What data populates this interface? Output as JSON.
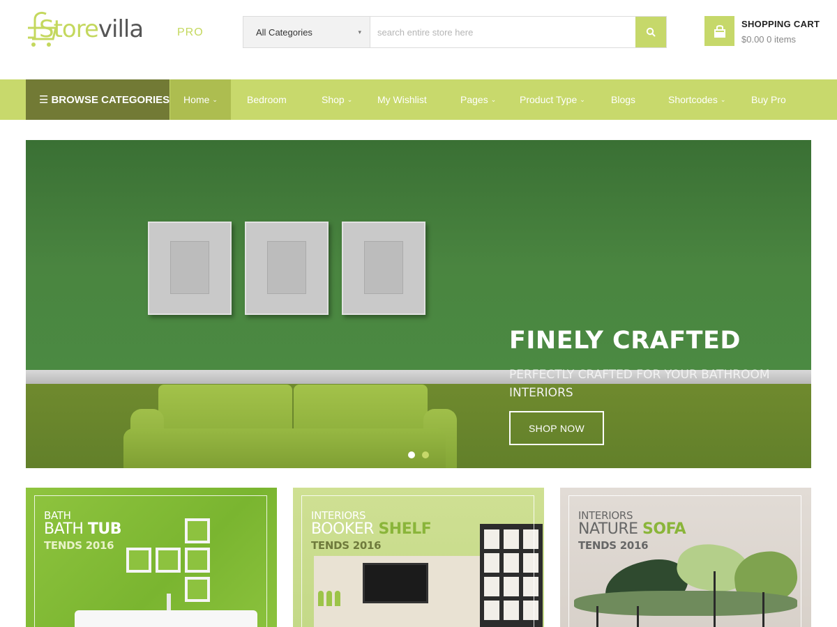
{
  "logo": {
    "text_part1": "Store",
    "text_part2": "villa",
    "badge": "PRO"
  },
  "search": {
    "category_selected": "All Categories",
    "placeholder": "search entire store here",
    "button_icon": "search-icon"
  },
  "cart": {
    "title": "SHOPPING CART",
    "summary": "$0.00 0 items",
    "icon": "shopping-bag-icon"
  },
  "nav": {
    "browse_label": "BROWSE CATEGORIES",
    "items": [
      {
        "label": "Home",
        "has_dropdown": true,
        "active": true
      },
      {
        "label": "Bedroom",
        "has_dropdown": false
      },
      {
        "label": "Shop",
        "has_dropdown": true
      },
      {
        "label": "My Wishlist",
        "has_dropdown": false
      },
      {
        "label": "Pages",
        "has_dropdown": true
      },
      {
        "label": "Product Type",
        "has_dropdown": true
      },
      {
        "label": "Blogs",
        "has_dropdown": false
      },
      {
        "label": "Shortcodes",
        "has_dropdown": true
      },
      {
        "label": "Buy Pro",
        "has_dropdown": false
      }
    ]
  },
  "hero": {
    "title": "FINELY CRAFTED",
    "subtitle": "PERFECTLY CRAFTED FOR YOUR BATHROOM INTERIORS",
    "button_label": "SHOP NOW",
    "slide_count": 2,
    "active_slide": 1
  },
  "promos": [
    {
      "category": "BATH",
      "name_part1": "BATH",
      "name_part2": "TUB",
      "trend": "TENDS 2016"
    },
    {
      "category": "INTERIORS",
      "name_part1": "BOOKER",
      "name_part2": "SHELF",
      "trend": "TENDS 2016"
    },
    {
      "category": "INTERIORS",
      "name_part1": "NATURE",
      "name_part2": "SOFA",
      "trend": "TENDS 2016"
    }
  ],
  "colors": {
    "accent": "#c8d96c",
    "browse_bg": "#727a35",
    "nav_active": "#adbd50",
    "hero_wall": "#3f7a38"
  }
}
